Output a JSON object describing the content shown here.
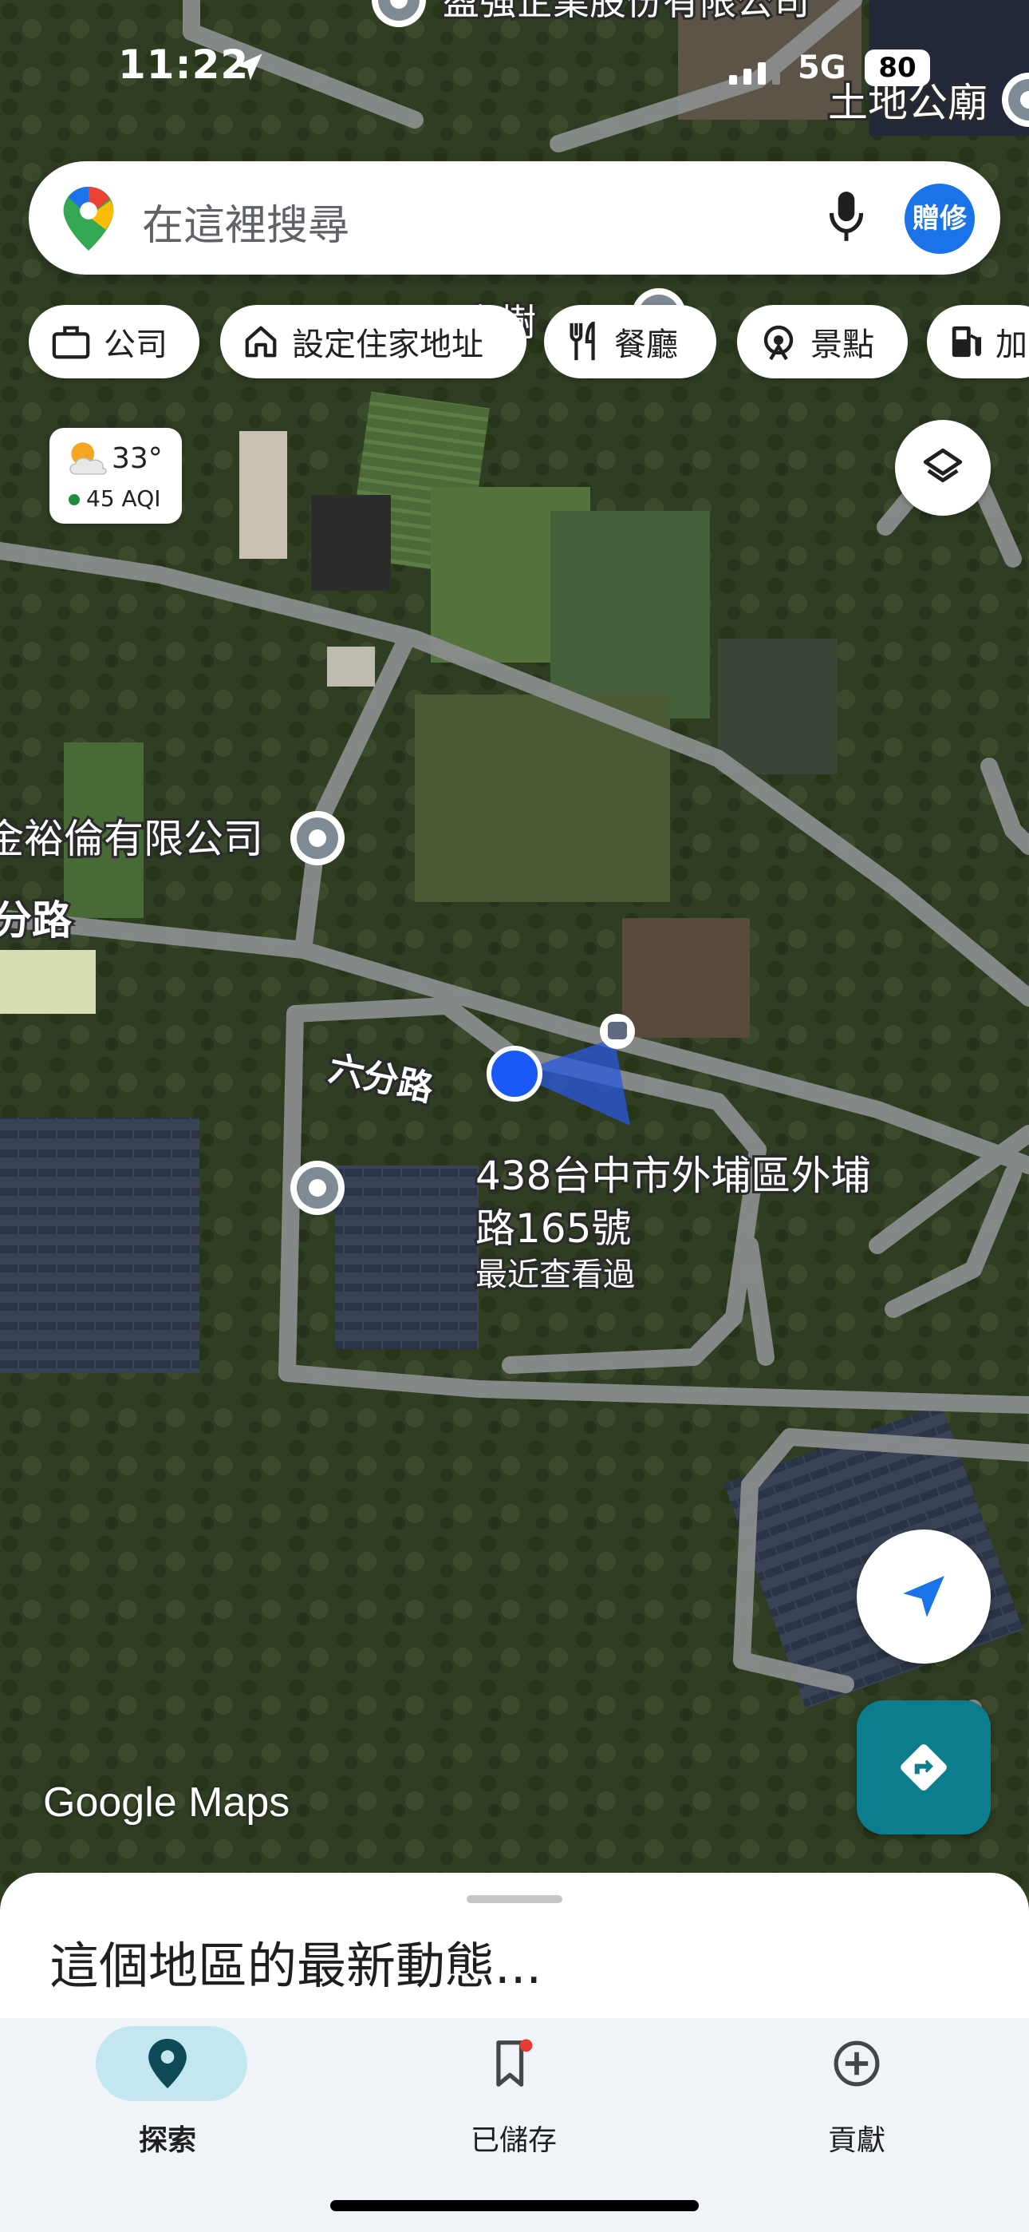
{
  "status_bar": {
    "time": "11:22",
    "network": "5G",
    "battery": "80"
  },
  "search": {
    "placeholder": "在這裡搜尋",
    "avatar_text": "贈修"
  },
  "chips": [
    {
      "label": "公司",
      "icon": "briefcase-icon"
    },
    {
      "label": "設定住家地址",
      "icon": "home-icon"
    },
    {
      "label": "餐廳",
      "icon": "restaurant-icon"
    },
    {
      "label": "景點",
      "icon": "attraction-icon"
    },
    {
      "label": "加",
      "icon": "gas-station-icon"
    }
  ],
  "weather": {
    "temp": "33°",
    "aqi": "45 AQI"
  },
  "map_labels": {
    "top_company": "盈強企業股份有限公司",
    "top_temple": "土地公廟",
    "company_left": "金裕倫有限公司",
    "road_left": "分路",
    "road_name": "六分路",
    "address_line1": "438台中市外埔區外埔",
    "address_line2": "路165號",
    "recent": "最近查看過",
    "partial_top": "家樹"
  },
  "logo": {
    "google": "Google",
    "maps": "Maps"
  },
  "sheet": {
    "title": "這個地區的最新動態..."
  },
  "bottom_nav": [
    {
      "label": "探索",
      "icon": "location-pin-icon",
      "active": true
    },
    {
      "label": "已儲存",
      "icon": "bookmark-icon",
      "active": false
    },
    {
      "label": "貢獻",
      "icon": "add-circle-icon",
      "active": false
    }
  ],
  "colors": {
    "accent": "#1a73e8",
    "directions": "#0b7d8d",
    "nav_active_pill": "#c2e7f0"
  }
}
